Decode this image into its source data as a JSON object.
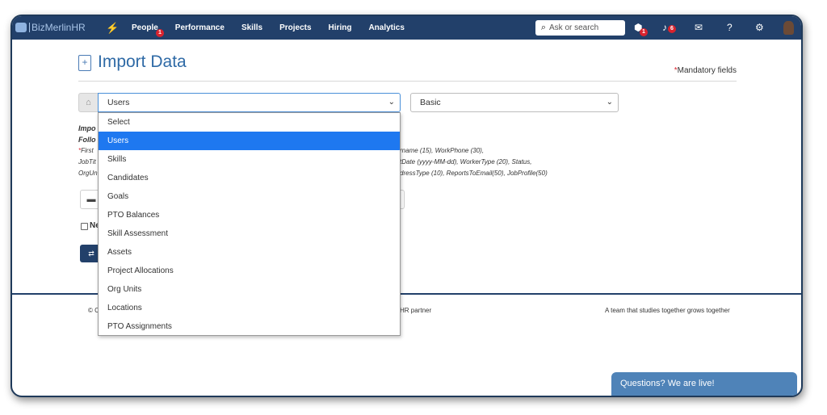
{
  "topbar": {
    "logo_text": "BizMerlinHR",
    "nav": [
      {
        "label": "People",
        "badge": "1"
      },
      {
        "label": "Performance"
      },
      {
        "label": "Skills"
      },
      {
        "label": "Projects"
      },
      {
        "label": "Hiring"
      },
      {
        "label": "Analytics"
      }
    ],
    "search_placeholder": "Ask or search",
    "gift_badge": "1",
    "notification_badge": "6"
  },
  "page": {
    "title": "Import Data",
    "mandatory_star": "*",
    "mandatory_label": "Mandatory fields"
  },
  "form": {
    "entity_selected": "Users",
    "mode_selected": "Basic",
    "import_line_1": "Impo",
    "import_line_2": "Follo",
    "fields_left": [
      "First",
      "JobTit",
      "OrgUn"
    ],
    "fields_left_star": "*",
    "fields_right": [
      "rname (15), WorkPhone (30),",
      "tDate (yyyy-MM-dd), WorkerType (20), Status,",
      "dressType (10), ReportsToEmail(50), JobProfile(50)"
    ],
    "checkbox_label": "Ne",
    "import_button_label": "⇄"
  },
  "dropdown": {
    "options": [
      "Select",
      "Users",
      "Skills",
      "Candidates",
      "Goals",
      "PTO Balances",
      "Skill Assessment",
      "Assets",
      "Project Allocations",
      "Org Units",
      "Locations",
      "PTO Assignments"
    ],
    "highlighted_index": 1
  },
  "footer": {
    "copyright": "© C",
    "partner": "linHR partner",
    "slogan": "A team that studies together grows together"
  },
  "chat": {
    "label": "Questions? We are live!"
  },
  "colors": {
    "topbar": "#22406a",
    "title": "#2f6aa6",
    "highlight": "#1e78f0",
    "chat": "#4f83b8",
    "badge": "#d9232e"
  }
}
